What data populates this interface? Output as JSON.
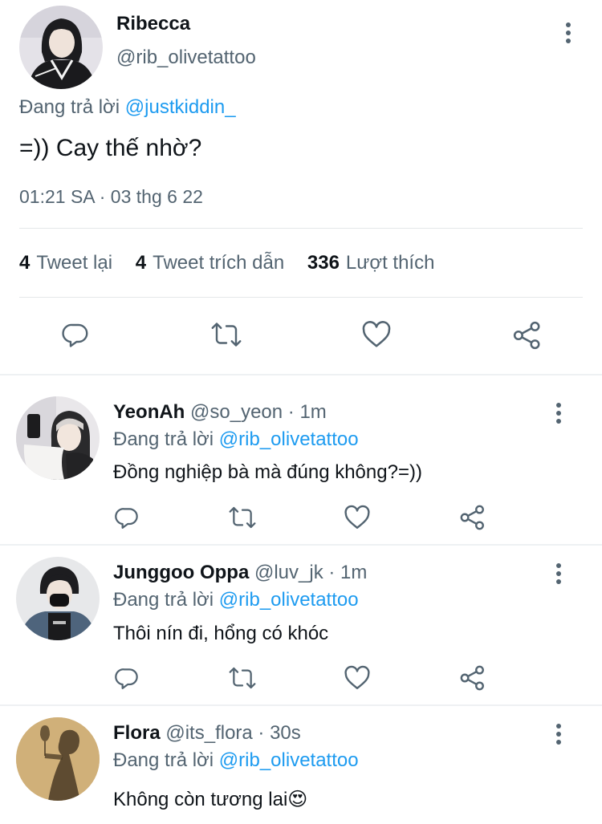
{
  "main_tweet": {
    "name": "Ribecca",
    "handle": "@rib_olivetattoo",
    "reply_prefix": "Đang trả lời",
    "reply_to": "@justkiddin_",
    "text": "=)) Cay thế nhờ?",
    "timestamp": "01:21 SA · 03 thg 6 22",
    "stats": {
      "retweets_count": "4",
      "retweets_label": "Tweet lại",
      "quotes_count": "4",
      "quotes_label": "Tweet trích dẫn",
      "likes_count": "336",
      "likes_label": "Lượt thích"
    }
  },
  "replies": [
    {
      "name": "YeonAh",
      "meta": "@so_yeon · 1m",
      "reply_prefix": "Đang trả lời",
      "reply_to": "@rib_olivetattoo",
      "text": "Đồng nghiệp bà mà đúng không?=))"
    },
    {
      "name": "Junggoo Oppa",
      "meta": "@luv_jk · 1m",
      "reply_prefix": "Đang trả lời",
      "reply_to": "@rib_olivetattoo",
      "text": "Thôi nín đi, hổng có khóc"
    },
    {
      "name": "Flora",
      "meta": "@its_flora · 30s",
      "reply_prefix": "Đang trả lời",
      "reply_to": "@rib_olivetattoo",
      "text": "Không còn tương lai😍"
    }
  ],
  "icons": {
    "reply": "reply-icon",
    "retweet": "retweet-icon",
    "like": "heart-icon",
    "share": "share-icon",
    "more": "more-icon"
  },
  "colors": {
    "text": "#0f1419",
    "secondary": "#536471",
    "link": "#1d9bf0",
    "divider": "#e5e7e9"
  }
}
